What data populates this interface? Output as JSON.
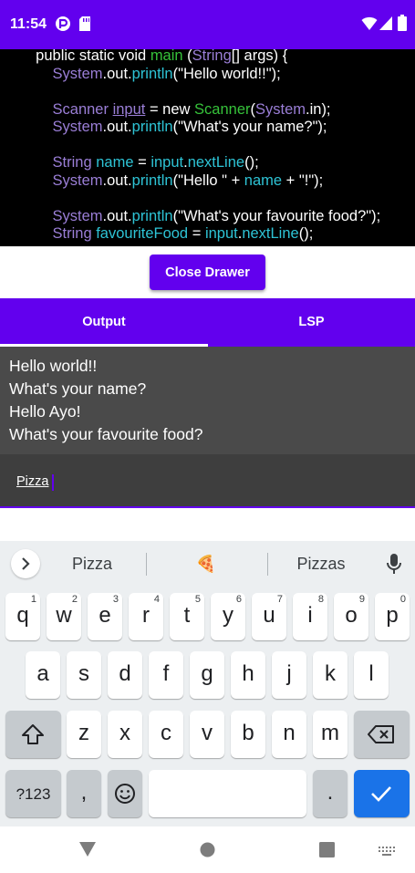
{
  "status_bar": {
    "time": "11:54",
    "left_icons": [
      "app-notification-icon",
      "sd-card-icon"
    ],
    "right_icons": [
      "wifi-icon",
      "cell-signal-icon",
      "battery-icon"
    ],
    "background": "#6200ee"
  },
  "code_editor": {
    "lines": [
      [
        {
          "t": "  public static void ",
          "k": "plain"
        },
        {
          "t": "main",
          "k": "decl"
        },
        {
          "t": " (",
          "k": "plain"
        },
        {
          "t": "String",
          "k": "class"
        },
        {
          "t": "[] args) {",
          "k": "plain"
        }
      ],
      [
        {
          "t": "      ",
          "k": "plain"
        },
        {
          "t": "System",
          "k": "class"
        },
        {
          "t": ".out.",
          "k": "plain"
        },
        {
          "t": "println",
          "k": "method"
        },
        {
          "t": "(\"Hello world!!\");",
          "k": "plain"
        }
      ],
      [],
      [
        {
          "t": "      ",
          "k": "plain"
        },
        {
          "t": "Scanner",
          "k": "class"
        },
        {
          "t": " ",
          "k": "plain"
        },
        {
          "t": "input",
          "k": "ul"
        },
        {
          "t": " = new ",
          "k": "plain"
        },
        {
          "t": "Scanner",
          "k": "decl"
        },
        {
          "t": "(",
          "k": "plain"
        },
        {
          "t": "System",
          "k": "class"
        },
        {
          "t": ".in);",
          "k": "plain"
        }
      ],
      [
        {
          "t": "      ",
          "k": "plain"
        },
        {
          "t": "System",
          "k": "class"
        },
        {
          "t": ".out.",
          "k": "plain"
        },
        {
          "t": "println",
          "k": "method"
        },
        {
          "t": "(\"What's your name?\");",
          "k": "plain"
        }
      ],
      [],
      [
        {
          "t": "      ",
          "k": "plain"
        },
        {
          "t": "String",
          "k": "class"
        },
        {
          "t": " ",
          "k": "plain"
        },
        {
          "t": "name",
          "k": "method"
        },
        {
          "t": " = ",
          "k": "plain"
        },
        {
          "t": "input",
          "k": "method"
        },
        {
          "t": ".",
          "k": "plain"
        },
        {
          "t": "nextLine",
          "k": "method"
        },
        {
          "t": "();",
          "k": "plain"
        }
      ],
      [
        {
          "t": "      ",
          "k": "plain"
        },
        {
          "t": "System",
          "k": "class"
        },
        {
          "t": ".out.",
          "k": "plain"
        },
        {
          "t": "println",
          "k": "method"
        },
        {
          "t": "(\"Hello \" + ",
          "k": "plain"
        },
        {
          "t": "name",
          "k": "method"
        },
        {
          "t": " + \"!\");",
          "k": "plain"
        }
      ],
      [],
      [
        {
          "t": "      ",
          "k": "plain"
        },
        {
          "t": "System",
          "k": "class"
        },
        {
          "t": ".out.",
          "k": "plain"
        },
        {
          "t": "println",
          "k": "method"
        },
        {
          "t": "(\"What's your favourite food?\");",
          "k": "plain"
        }
      ],
      [
        {
          "t": "      ",
          "k": "plain"
        },
        {
          "t": "String",
          "k": "class"
        },
        {
          "t": " ",
          "k": "plain"
        },
        {
          "t": "favouriteFood",
          "k": "method"
        },
        {
          "t": " = ",
          "k": "plain"
        },
        {
          "t": "input",
          "k": "method"
        },
        {
          "t": ".",
          "k": "plain"
        },
        {
          "t": "nextLine",
          "k": "method"
        },
        {
          "t": "();",
          "k": "plain"
        }
      ]
    ]
  },
  "drawer": {
    "close_label": "Close Drawer"
  },
  "tabs": {
    "items": [
      {
        "label": "Output",
        "selected": true
      },
      {
        "label": "LSP",
        "selected": false
      }
    ]
  },
  "console": {
    "output_lines": [
      "Hello world!!",
      "What's your name?",
      "Hello Ayo!",
      "What's your favourite food?"
    ],
    "input_value": "Pizza"
  },
  "keyboard": {
    "suggestions": [
      "Pizza",
      "🍕",
      "Pizzas"
    ],
    "row1": [
      {
        "key": "q",
        "hint": "1"
      },
      {
        "key": "w",
        "hint": "2"
      },
      {
        "key": "e",
        "hint": "3"
      },
      {
        "key": "r",
        "hint": "4"
      },
      {
        "key": "t",
        "hint": "5"
      },
      {
        "key": "y",
        "hint": "6"
      },
      {
        "key": "u",
        "hint": "7"
      },
      {
        "key": "i",
        "hint": "8"
      },
      {
        "key": "o",
        "hint": "9"
      },
      {
        "key": "p",
        "hint": "0"
      }
    ],
    "row2": [
      "a",
      "s",
      "d",
      "f",
      "g",
      "h",
      "j",
      "k",
      "l"
    ],
    "row3": [
      "z",
      "x",
      "c",
      "v",
      "b",
      "n",
      "m"
    ],
    "row4": {
      "symbols": "?123",
      "comma": ",",
      "period": "."
    },
    "enter_color": "#1a73e8"
  },
  "nav_bar": {
    "icons": [
      "back-icon",
      "home-icon",
      "recents-icon",
      "keyboard-switch-icon"
    ]
  }
}
